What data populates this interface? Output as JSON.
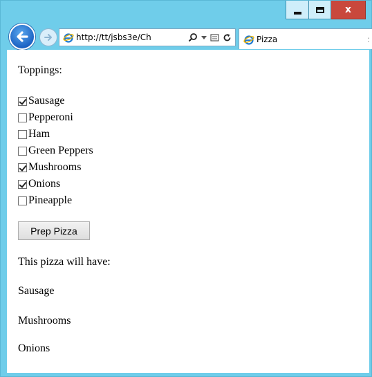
{
  "window": {
    "minimize_icon": "minimize-icon",
    "maximize_icon": "maximize-icon",
    "close_icon": "close-icon",
    "close_glyph": "x",
    "close_color": "#c9483c",
    "frame_color": "#6fcdea"
  },
  "nav": {
    "back_icon": "back-arrow-icon",
    "forward_icon": "forward-arrow-icon",
    "url": "http://tt/jsbs3e/Ch",
    "tab_title": "Pizza"
  },
  "page": {
    "toppings_label": "Toppings:",
    "toppings": [
      {
        "label": "Sausage",
        "checked": true
      },
      {
        "label": "Pepperoni",
        "checked": false
      },
      {
        "label": "Ham",
        "checked": false
      },
      {
        "label": "Green Peppers",
        "checked": false
      },
      {
        "label": "Mushrooms",
        "checked": true
      },
      {
        "label": "Onions",
        "checked": true
      },
      {
        "label": "Pineapple",
        "checked": false
      }
    ],
    "button_label": "Prep Pizza",
    "result_label": "This pizza will have:",
    "results": [
      "Sausage",
      "Mushrooms",
      "Onions"
    ]
  }
}
